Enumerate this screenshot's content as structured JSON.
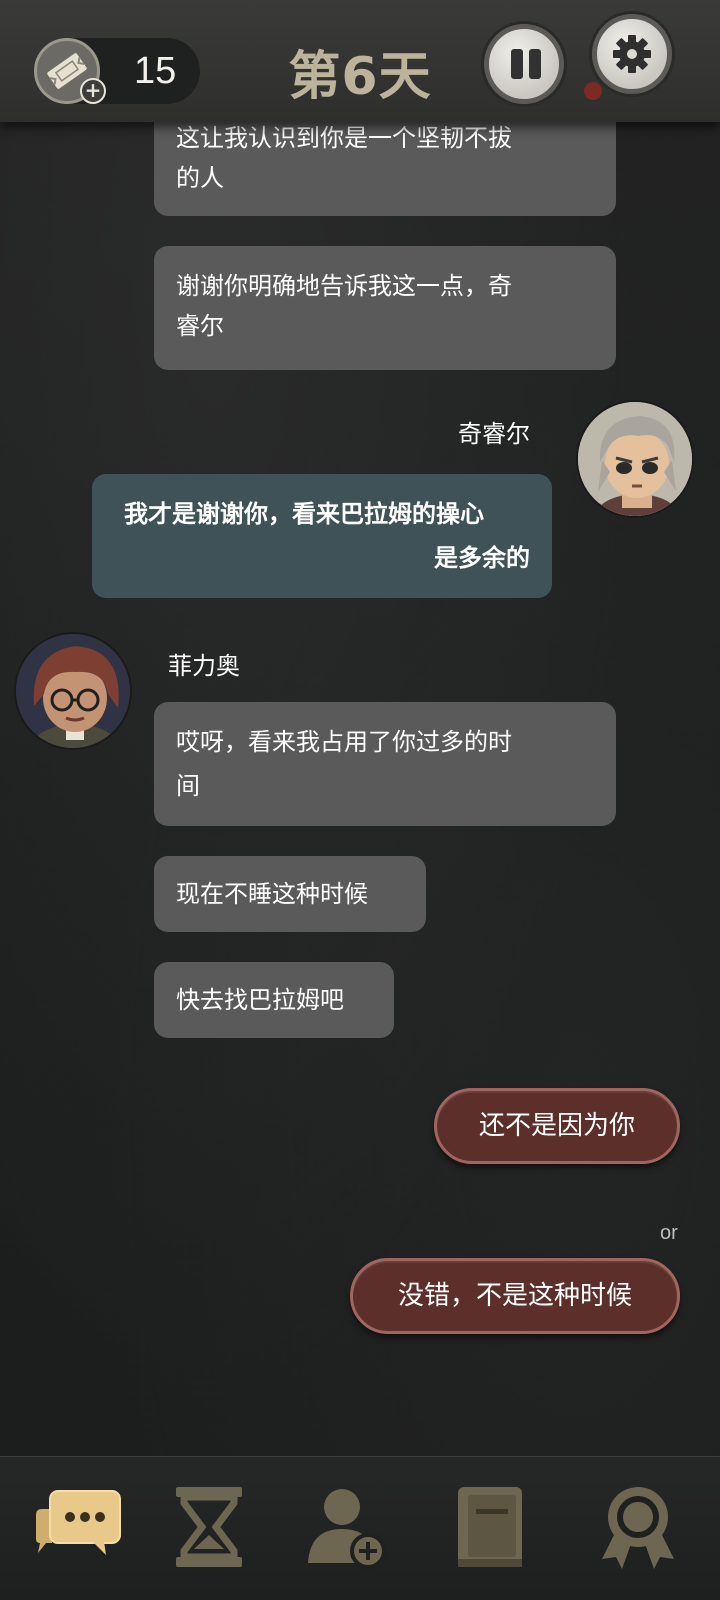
{
  "header": {
    "ticket_count": "15",
    "day_title": "第6天"
  },
  "messages": [
    {
      "sender": "other",
      "text": "这让我认识到你是一个坚韧不拔的人"
    },
    {
      "sender": "other",
      "text": "谢谢你明确地告诉我这一点，奇睿尔"
    },
    {
      "sender": "self",
      "name": "奇睿尔",
      "text_line1": "我才是谢谢你，看来巴拉姆的操心",
      "text_line2": "是多余的"
    },
    {
      "sender": "other",
      "name": "菲力奥",
      "text": "哎呀，看来我占用了你过多的时间"
    },
    {
      "sender": "other",
      "text": "现在不睡这种时候"
    },
    {
      "sender": "other",
      "text": "快去找巴拉姆吧"
    }
  ],
  "partial_top_line1": "这让我认识到你是一个坚韧不拔",
  "partial_top_line2": "的人",
  "msg2_line1": "谢谢你明确地告诉我这一点，奇",
  "msg2_line2": "睿尔",
  "msg4_line1": "哎呀，看来我占用了你过多的时",
  "msg4_line2": "间",
  "choices": {
    "option1": "还不是因为你",
    "separator": "or",
    "option2": "没错，不是这种时候"
  },
  "nav": {
    "items": [
      "chat-icon",
      "hourglass-icon",
      "add-contact-icon",
      "book-icon",
      "achievement-badge-icon"
    ],
    "active_color": "#e8c98a",
    "inactive_color": "#6d6650"
  }
}
